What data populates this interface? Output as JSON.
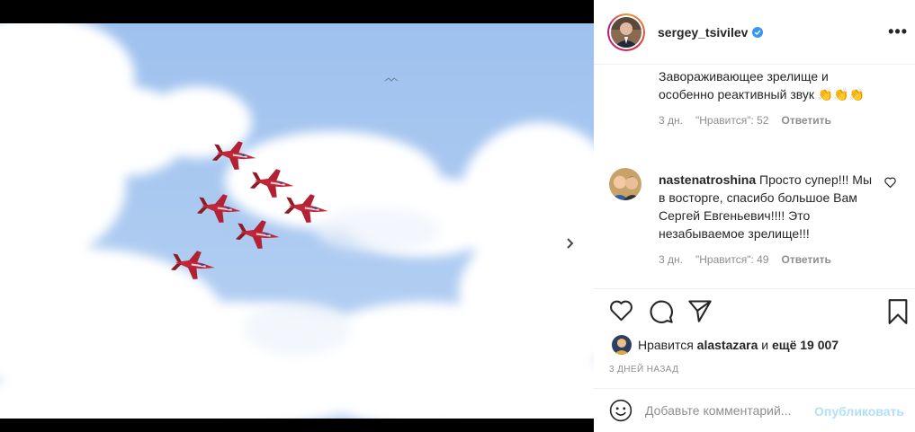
{
  "post": {
    "author": "sergey_tsivilev",
    "verified": true,
    "more_icon": "more-horizontal-icon",
    "carousel": {
      "slides": 7,
      "active": 0
    }
  },
  "comments": [
    {
      "text": "Завораживающее зрелище и особенно реактивный звук 👏👏👏",
      "time": "3 дн.",
      "likes": "\"Нравится\": 52",
      "reply": "Ответить"
    },
    {
      "user": "nastenatroshina",
      "text": "Просто супер!!! Мы в восторге, спасибо большое Вам Сергей Евгеньевич!!!! Это незабываемое зрелище!!!",
      "time": "3 дн.",
      "likes": "\"Нравится\": 49",
      "reply": "Ответить"
    }
  ],
  "likes": {
    "prefix": "Нравится",
    "user": "alastazara",
    "conj": "и",
    "others": "ещё 19 007"
  },
  "date": "3 ДНЕЙ НАЗАД",
  "add_comment": {
    "placeholder": "Добавьте комментарий...",
    "publish": "Опубликовать"
  },
  "colors": {
    "accent": "#3897f0",
    "publish_disabled": "#b2dffc",
    "verified": "#3897f0"
  }
}
